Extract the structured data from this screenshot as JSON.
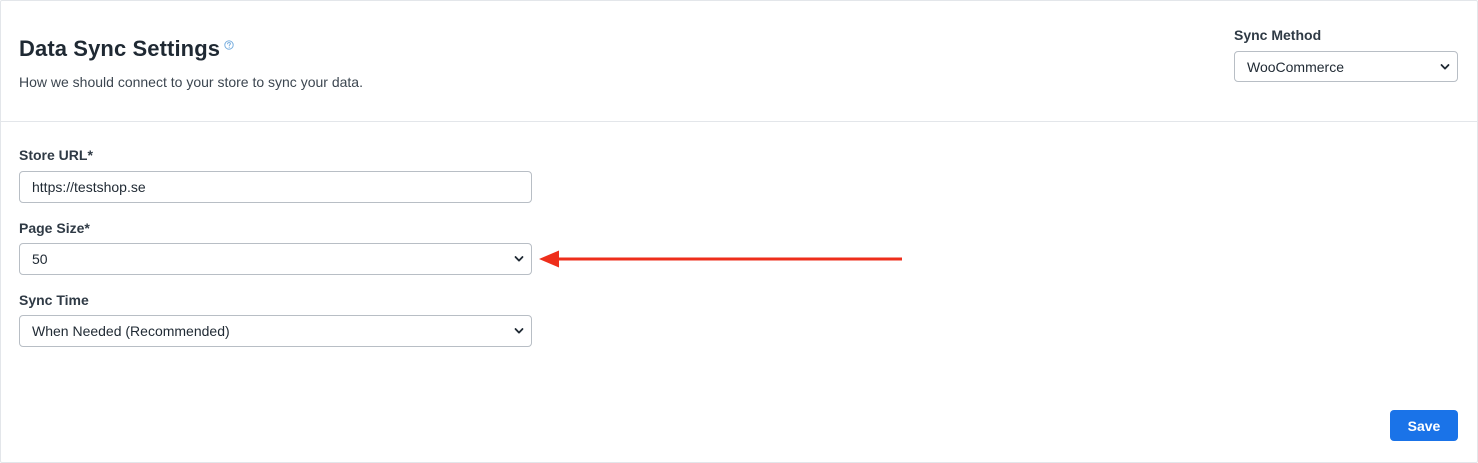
{
  "header": {
    "title": "Data Sync Settings",
    "subtitle": "How we should connect to your store to sync your data.",
    "help_icon": "question-circle-icon"
  },
  "sync_method": {
    "label": "Sync Method",
    "value": "WooCommerce"
  },
  "form": {
    "store_url": {
      "label": "Store URL*",
      "value": "https://testshop.se"
    },
    "page_size": {
      "label": "Page Size*",
      "value": "50"
    },
    "sync_time": {
      "label": "Sync Time",
      "value": "When Needed (Recommended)"
    }
  },
  "annotation": {
    "icon": "arrow-left-icon",
    "color": "#ee2e1b"
  },
  "actions": {
    "save_label": "Save"
  },
  "colors": {
    "primary": "#1a73e8",
    "help_icon": "#6ea8dc"
  }
}
